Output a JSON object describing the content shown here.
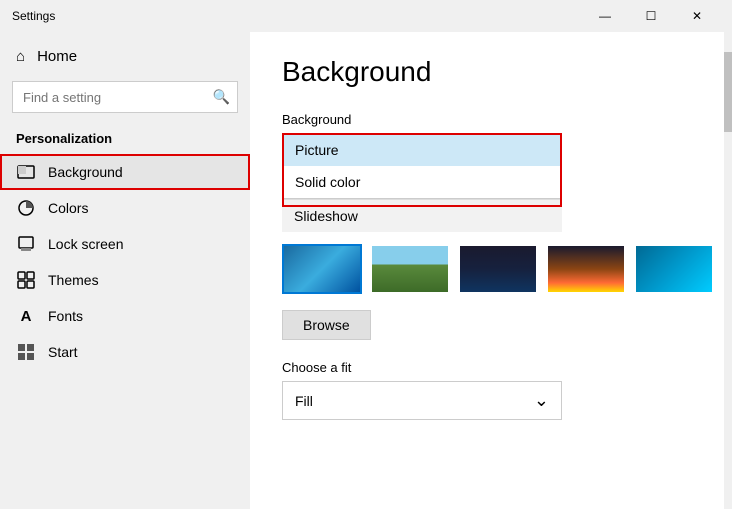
{
  "window": {
    "title": "Settings",
    "controls": {
      "minimize": "—",
      "maximize": "☐",
      "close": "✕"
    }
  },
  "sidebar": {
    "home_label": "Home",
    "search_placeholder": "Find a setting",
    "section_title": "Personalization",
    "items": [
      {
        "id": "background",
        "label": "Background",
        "icon": "🖼",
        "active": true
      },
      {
        "id": "colors",
        "label": "Colors",
        "icon": "◕"
      },
      {
        "id": "lock-screen",
        "label": "Lock screen",
        "icon": "🖥"
      },
      {
        "id": "themes",
        "label": "Themes",
        "icon": "🎨"
      },
      {
        "id": "fonts",
        "label": "Fonts",
        "icon": "A"
      },
      {
        "id": "start",
        "label": "Start",
        "icon": "⊞"
      }
    ]
  },
  "main": {
    "title": "Background",
    "background_label": "Background",
    "dropdown_options": [
      {
        "id": "picture",
        "label": "Picture",
        "selected": true
      },
      {
        "id": "solid-color",
        "label": "Solid color",
        "selected": false
      },
      {
        "id": "slideshow",
        "label": "Slideshow",
        "selected": false
      }
    ],
    "browse_label": "Browse",
    "fit_label": "Choose a fit",
    "fit_value": "Fill",
    "fit_arrow": "⌄"
  }
}
